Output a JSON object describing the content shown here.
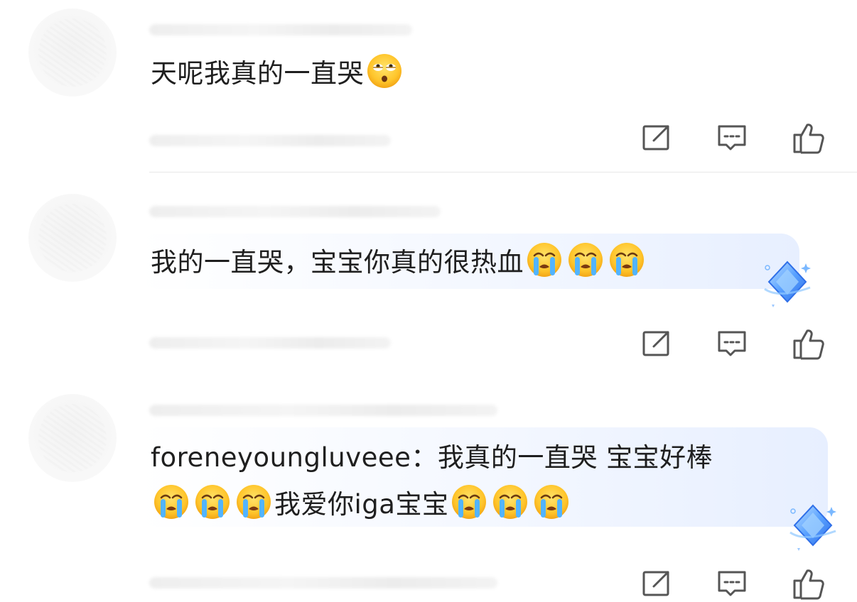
{
  "comments": [
    {
      "text": "天呢我真的一直哭",
      "emojis_after": [
        "eye-roll-emoji"
      ],
      "has_bubble": false
    },
    {
      "text": "我的一直哭，宝宝你真的很热血",
      "emojis_after": [
        "crying-emoji",
        "crying-emoji",
        "crying-emoji"
      ],
      "has_bubble": true
    },
    {
      "line1": "foreneyoungluveee：我真的一直哭 宝宝好棒",
      "line2_mid": "我爱你iga宝宝",
      "emojis_before": [
        "crying-emoji",
        "crying-emoji",
        "crying-emoji"
      ],
      "emojis_after": [
        "crying-emoji",
        "crying-emoji",
        "crying-emoji"
      ],
      "has_bubble": true
    }
  ],
  "actions": {
    "icons": [
      "share-icon",
      "comment-icon",
      "like-icon"
    ]
  },
  "colors": {
    "icon": "#555555",
    "bubble_start": "#ffffff",
    "bubble_end": "#e7efff",
    "badge": "#4a8dff"
  }
}
